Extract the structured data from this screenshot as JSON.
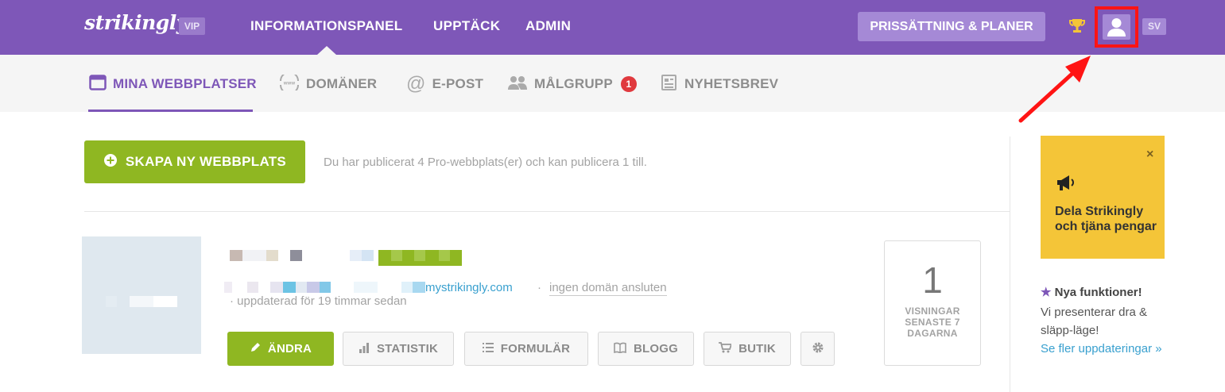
{
  "header": {
    "logo": "strikingly",
    "vip_badge": "VIP",
    "nav": [
      "INFORMATIONSPANEL",
      "UPPTÄCK",
      "ADMIN"
    ],
    "pricing_button": "PRISSÄTTNING & PLANER",
    "language": "SV",
    "icons": [
      "trophy-icon",
      "user-avatar-icon"
    ],
    "accent_color": "#7e57b8"
  },
  "subnav": {
    "items": [
      {
        "label": "MINA WEBBPLATSER",
        "icon": "browser-window-icon",
        "active": true
      },
      {
        "label": "DOMÄNER",
        "icon": "www-icon"
      },
      {
        "label": "E-POST",
        "icon": "at-icon"
      },
      {
        "label": "MÅLGRUPP",
        "icon": "people-icon",
        "badge": "1"
      },
      {
        "label": "NYHETSBREV",
        "icon": "newsletter-icon"
      }
    ]
  },
  "main": {
    "create_button": "SKAPA NY WEBBPLATS",
    "publish_info": "Du har publicerat 4 Pro-webbplats(er) och kan publicera 1 till.",
    "site": {
      "url_suffix": "mystrikingly.com",
      "separator": "·",
      "no_domain": "ingen domän ansluten",
      "updated": "uppdaterad för 19 timmar sedan",
      "actions": [
        {
          "label": "ÄNDRA",
          "icon": "pencil-icon"
        },
        {
          "label": "STATISTIK",
          "icon": "bar-chart-icon"
        },
        {
          "label": "FORMULÄR",
          "icon": "list-icon"
        },
        {
          "label": "BLOGG",
          "icon": "book-icon"
        },
        {
          "label": "BUTIK",
          "icon": "cart-icon"
        }
      ],
      "views_count": "1",
      "views_label": "VISNINGAR SENASTE 7 DAGARNA"
    }
  },
  "sidebar": {
    "promo_close": "×",
    "promo_text": "Dela Strikingly och tjäna pengar",
    "news_title": "Nya funktioner!",
    "news_body": "Vi presenterar dra & släpp-läge!",
    "news_link": "Se fler uppdateringar »"
  }
}
